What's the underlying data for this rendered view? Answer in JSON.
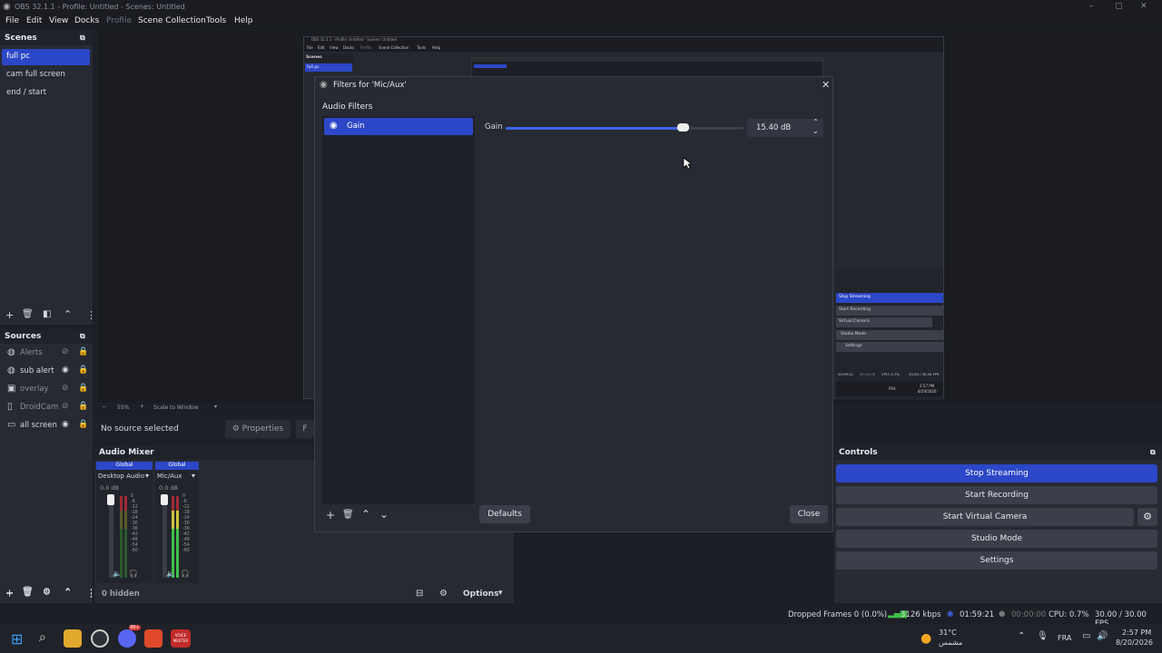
{
  "window": {
    "title": "OBS 32.1.1 - Profile: Untitled - Scenes: Untitled",
    "controls": [
      "–",
      "▢",
      "✕"
    ]
  },
  "menu": [
    "File",
    "Edit",
    "View",
    "Docks",
    "Profile",
    "Scene Collection",
    "Tools",
    "Help"
  ],
  "scenes": {
    "title": "Scenes",
    "items": [
      "full pc",
      "cam full screen",
      "end / start"
    ],
    "active_index": 0
  },
  "sources": {
    "title": "Sources",
    "items": [
      {
        "label": "Alerts",
        "visible": false,
        "icon": "globe-icon"
      },
      {
        "label": "sub alert",
        "visible": true,
        "icon": "globe-icon"
      },
      {
        "label": "overlay",
        "visible": false,
        "icon": "image-icon"
      },
      {
        "label": "DroidCam",
        "visible": false,
        "icon": "camera-icon"
      },
      {
        "label": "all screen",
        "visible": true,
        "icon": "display-icon"
      }
    ],
    "hidden_count": "0 hidden"
  },
  "preview_bar": {
    "zoom": "55%",
    "scale": "Scale to Window"
  },
  "context_bar": {
    "no_source": "No source selected",
    "properties": "Properties",
    "filters_partial": "F"
  },
  "dialog": {
    "title": "Filters for 'Mic/Aux'",
    "section": "Audio Filters",
    "filter_name": "Gain",
    "param_label": "Gain",
    "param_value": "15.40 dB",
    "slider_fraction": 0.745,
    "defaults": "Defaults",
    "close": "Close"
  },
  "mixer": {
    "title": "Audio Mixer",
    "channels": [
      {
        "global": "Global",
        "name": "Desktop Audio",
        "db": "0.0 dB"
      },
      {
        "global": "Global",
        "name": "Mic/Aux",
        "db": "0.0 dB"
      }
    ],
    "scale": [
      "0",
      "-6",
      "-12",
      "-18",
      "-24",
      "-30",
      "-36",
      "-42",
      "-48",
      "-54",
      "-60"
    ],
    "options": "Options"
  },
  "controls": {
    "title": "Controls",
    "stop_streaming": "Stop Streaming",
    "start_recording": "Start Recording",
    "start_virtual_camera": "Start Virtual Camera",
    "studio_mode": "Studio Mode",
    "settings": "Settings"
  },
  "nested_preview": {
    "title": "OBS 32.1.1 - Profile: Untitled - Scenes: Untitled",
    "menu": [
      "File",
      "Edit",
      "View",
      "Docks",
      "Profile",
      "Scene Collection",
      "Tools",
      "Help"
    ],
    "scenes_title": "Scenes",
    "scene_active": "full pc",
    "stop_streaming": "Stop Streaming",
    "start_recording": "Start Recording",
    "start_virtual_camera": "Virtual Camera",
    "studio_mode": "Studio Mode",
    "settings": "Settings",
    "status_cpu": "CPU: 0.7%",
    "status_fps": "30.00 / 30.00 FPS",
    "status_time": "00:59:21",
    "status_rec": "00:00:00",
    "clock_time": "2:57 PM",
    "clock_date": "8/20/2026",
    "lang": "FRA"
  },
  "status": {
    "dropped": "Dropped Frames 0 (0.0%)",
    "bitrate": "3126 kbps",
    "stream_time": "01:59:21",
    "rec_time": "00:00:00",
    "cpu": "CPU: 0.7%",
    "fps": "30.00 / 30.00 FPS"
  },
  "taskbar": {
    "weather_temp": "31°C",
    "weather_desc": "مشمس",
    "lang": "FRA",
    "time": "2:57 PM",
    "date": "8/20/2026",
    "badge": "99+",
    "voice_label": "VOICE\nMEETER"
  },
  "colors": {
    "accent": "#2c47c7",
    "meter_green": "#3fbf4a",
    "meter_yellow": "#c8c43a",
    "meter_red": "#a02a34"
  }
}
